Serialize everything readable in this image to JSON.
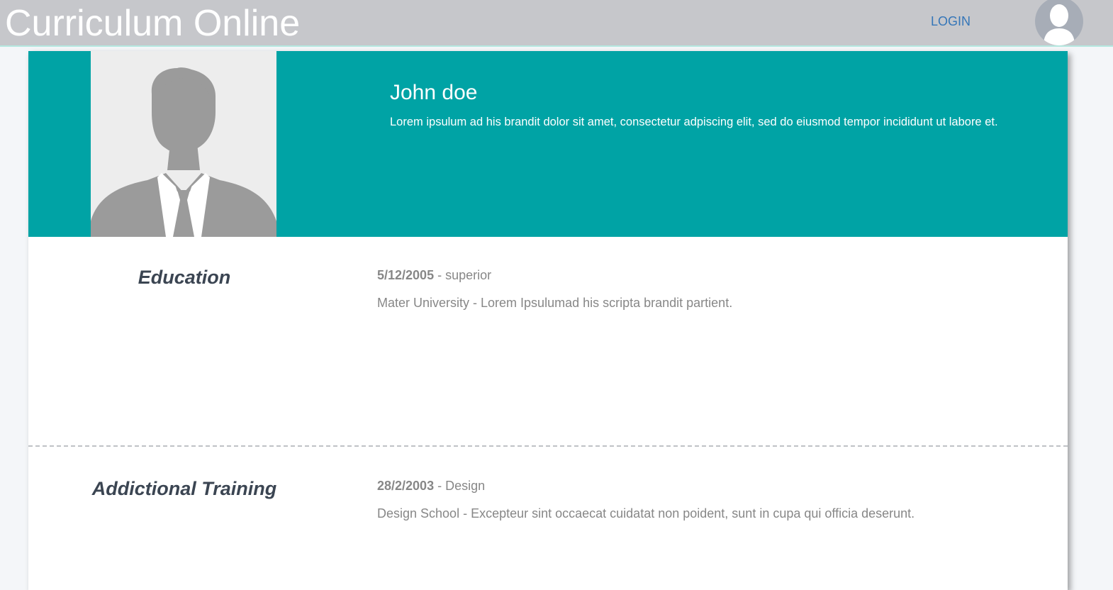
{
  "header": {
    "brand": "Curriculum Online",
    "login_label": "LOGIN",
    "avatar_icon": "user-avatar-icon"
  },
  "profile": {
    "name": "John doe",
    "bio": "Lorem ipsulum ad his brandit dolor sit amet, consectetur adpiscing elit, sed do eiusmod tempor incididunt ut labore et.",
    "photo_icon": "person-silhouette-icon"
  },
  "sections": [
    {
      "title": "Education",
      "date": "5/12/2005",
      "separator": " - ",
      "type": "superior",
      "description": "Mater University - Lorem Ipsulumad his scripta brandit partient."
    },
    {
      "title": "Addictional Training",
      "date": "28/2/2003",
      "separator": " - ",
      "type": "Design",
      "description": "Design School - Excepteur sint occaecat cuidatat non poident, sunt in cupa qui officia deserunt."
    }
  ],
  "colors": {
    "topbar": "#c6c7cb",
    "hero": "#00a3a5",
    "link": "#3576b8",
    "heading": "#3b4552",
    "muted": "#878787"
  }
}
